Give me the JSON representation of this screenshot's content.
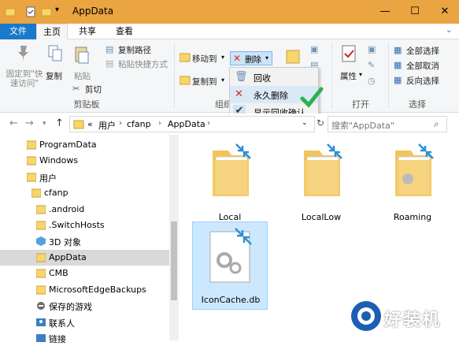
{
  "window": {
    "title": "AppData"
  },
  "tabs": {
    "file": "文件",
    "home": "主页",
    "share": "共享",
    "view": "查看"
  },
  "ribbon": {
    "pin_quick_access": "固定到\"快速访问\"",
    "copy": "复制",
    "paste": "粘贴",
    "copy_path": "复制路径",
    "paste_shortcut": "粘贴快捷方式",
    "cut": "剪切",
    "clipboard_group": "剪贴板",
    "move_to": "移动到",
    "copy_to": "复制到",
    "delete": "删除",
    "organize_group": "组织",
    "properties": "属性",
    "open_group": "打开",
    "select_all": "全部选择",
    "select_none": "全部取消",
    "invert_selection": "反向选择",
    "select_group": "选择"
  },
  "delete_menu": {
    "items": [
      {
        "label": "回收",
        "icon": "recycle-icon"
      },
      {
        "label": "永久删除",
        "icon": "delete-x-icon"
      },
      {
        "label": "显示回收确认",
        "icon": "check-icon"
      }
    ]
  },
  "address": {
    "overflow": "«",
    "crumbs": [
      "用户",
      "cfanp",
      "AppData"
    ],
    "search_placeholder": "搜索\"AppData\""
  },
  "nav": {
    "items": [
      {
        "label": "ProgramData",
        "icon": "folder-icon"
      },
      {
        "label": "Windows",
        "icon": "folder-icon"
      },
      {
        "label": "用户",
        "icon": "folder-icon"
      },
      {
        "label": "cfanp",
        "icon": "folder-icon"
      },
      {
        "label": ".android",
        "icon": "folder-icon"
      },
      {
        "label": ".SwitchHosts",
        "icon": "folder-icon"
      },
      {
        "label": "3D 对象",
        "icon": "3d-objects-icon"
      },
      {
        "label": "AppData",
        "icon": "folder-icon"
      },
      {
        "label": "CMB",
        "icon": "folder-icon"
      },
      {
        "label": "MicrosoftEdgeBackups",
        "icon": "folder-icon"
      },
      {
        "label": "保存的游戏",
        "icon": "saved-games-icon"
      },
      {
        "label": "联系人",
        "icon": "contacts-icon"
      },
      {
        "label": "链接",
        "icon": "links-icon"
      }
    ]
  },
  "files": [
    {
      "name": "Local",
      "type": "folder"
    },
    {
      "name": "LocalLow",
      "type": "folder"
    },
    {
      "name": "Roaming",
      "type": "folder"
    },
    {
      "name": "IconCache.db",
      "type": "file"
    }
  ],
  "watermark": {
    "text": "好装机"
  },
  "colors": {
    "titlebar": "#eaa441",
    "file_tab": "#1979ca",
    "selection": "#cce8ff",
    "folder": "#f5c75a"
  }
}
